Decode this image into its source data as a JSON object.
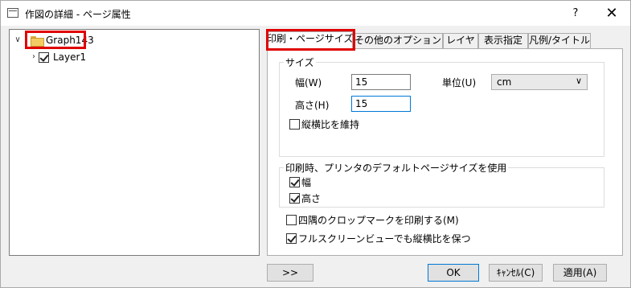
{
  "window": {
    "title": "作図の詳細 - ページ属性",
    "help_label": "?",
    "close_label": "✕"
  },
  "tree": {
    "root_label": "Graph143",
    "layer_label": "Layer1"
  },
  "tabs": [
    {
      "label": "印刷・ページサイズ"
    },
    {
      "label": "その他のオプション"
    },
    {
      "label": "レイヤ"
    },
    {
      "label": "表示指定"
    },
    {
      "label": "凡例/タイトル"
    }
  ],
  "size_group": {
    "title": "サイズ",
    "width_label": "幅(W)",
    "width_value": "15",
    "height_label": "高さ(H)",
    "height_value": "15",
    "unit_label": "単位(U)",
    "unit_value": "cm",
    "keep_ratio_label": "縦横比を維持",
    "keep_ratio_checked": false
  },
  "printer_group": {
    "title": "印刷時、プリンタのデフォルトページサイズを使用",
    "width_label": "幅",
    "width_checked": true,
    "height_label": "高さ",
    "height_checked": true
  },
  "options": {
    "crop_marks_label": "四隅のクロップマークを印刷する(M)",
    "crop_marks_checked": false,
    "fullscreen_label": "フルスクリーンビューでも縦横比を保つ",
    "fullscreen_checked": true
  },
  "buttons": {
    "expand_label": ">>",
    "ok_label": "OK",
    "cancel_label": "ｷｬﾝｾﾙ(C)",
    "apply_label": "適用(A)"
  },
  "colors": {
    "highlight_box": "#e00000",
    "focus_border": "#0078d7"
  }
}
